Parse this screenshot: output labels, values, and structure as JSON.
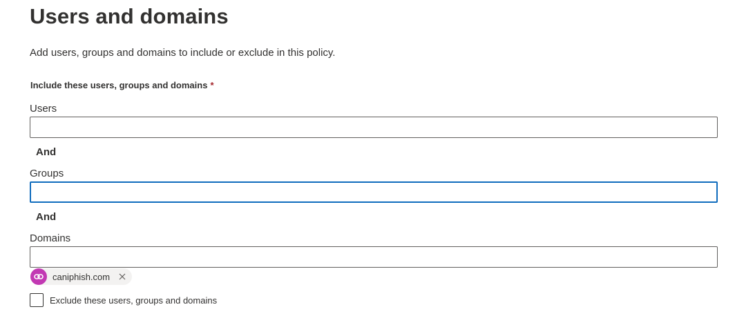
{
  "page": {
    "title": "Users and domains",
    "description": "Add users, groups and domains to include or exclude in this policy."
  },
  "include_section": {
    "label": "Include these users, groups and domains",
    "required_marker": "*"
  },
  "users": {
    "label": "Users",
    "value": ""
  },
  "and_1": "And",
  "groups": {
    "label": "Groups",
    "value": "",
    "focused": true
  },
  "and_2": "And",
  "domains": {
    "label": "Domains",
    "value": "",
    "chips": [
      {
        "text": "caniphish.com",
        "icon": "domain-link-icon",
        "color": "#c239b3"
      }
    ]
  },
  "exclude": {
    "label": "Exclude these users, groups and domains",
    "checked": false
  },
  "colors": {
    "focus_border": "#0f6cbd",
    "required": "#a4262c",
    "chip_avatar": "#c239b3"
  }
}
